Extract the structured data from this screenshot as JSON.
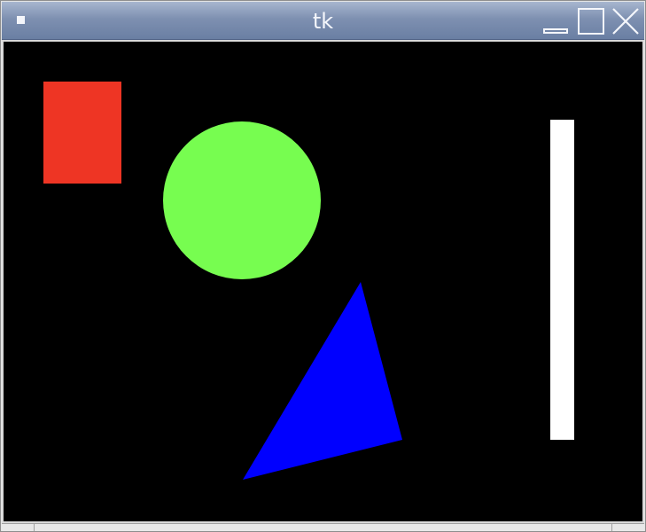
{
  "window": {
    "title": "tk"
  },
  "titlebar": {
    "menu_icon": "window-menu-icon",
    "buttons": [
      {
        "name": "minimize",
        "icon": "minimize-icon"
      },
      {
        "name": "maximize",
        "icon": "maximize-icon"
      },
      {
        "name": "close",
        "icon": "close-icon"
      }
    ]
  },
  "canvas": {
    "background": "#000000",
    "shapes": [
      {
        "kind": "rectangle",
        "color": "#ee3524"
      },
      {
        "kind": "circle",
        "color": "#77fd50"
      },
      {
        "kind": "triangle",
        "color": "#0000ff"
      },
      {
        "kind": "bar",
        "color": "#ffffff"
      }
    ]
  }
}
